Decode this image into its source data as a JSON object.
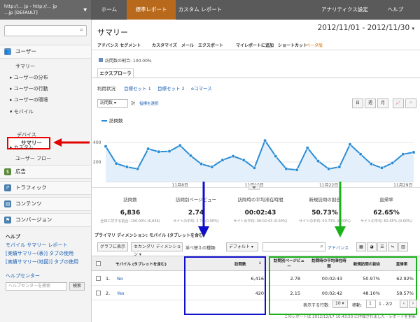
{
  "topbar": {
    "account_line1": "http://… jp - http://… jp",
    "account_line2": "…jp [DEFAULT]",
    "home": "ホーム",
    "standard_reports": "標準レポート",
    "custom_reports": "カスタム レポート",
    "analytics_settings": "アナリティクス設定",
    "help": "ヘルプ"
  },
  "sidebar": {
    "users_section": "ユーザー",
    "items": [
      "サマリー",
      "ユーザーの分布",
      "ユーザーの行動",
      "ユーザーの環境",
      "モバイル"
    ],
    "mobile_children": [
      "サマリー",
      "デバイス"
    ],
    "custom": "カスタム",
    "user_flow": "ユーザー フロー",
    "ads": "広告",
    "traffic": "トラフィック",
    "content": "コンテンツ",
    "conversion": "コンバージョン",
    "help_heading": "ヘルプ",
    "help_links": [
      "モバイル サマリー レポート",
      "[実績サマリー(表)] タブの使用",
      "[実績サマリー(地図)] タブの使用"
    ],
    "help_center": "ヘルプセンター",
    "help_search_placeholder": "ヘルプセンターを検索",
    "help_search_btn": "検索"
  },
  "main": {
    "title": "サマリー",
    "date_range": "2012/11/01 - 2012/11/30",
    "toolbar": {
      "advanced_segments": "アドバンス セグメント",
      "customize": "カスタマイズ",
      "email": "メール",
      "export": "エクスポート",
      "dashboard": "マイレポートに追加",
      "shortcut": "ショートカット",
      "beta": "ベータ版"
    },
    "visits_pct": "訪問数の割合: 100.00%",
    "explorer_tab": "エクスプローラ",
    "subtabs": [
      "利用状況",
      "目標セット 1",
      "目標セット 2",
      "eコマース"
    ],
    "metric_select": "訪問数",
    "vs": "対",
    "metric_compare": "指標を選択",
    "period_buttons": [
      "日",
      "週",
      "月"
    ],
    "legend": "訪問数"
  },
  "chart_data": {
    "type": "line",
    "title": "",
    "series": [
      {
        "name": "訪問数",
        "values": [
          360,
          185,
          150,
          130,
          335,
          305,
          310,
          370,
          265,
          180,
          150,
          220,
          260,
          220,
          140,
          420,
          260,
          130,
          120,
          345,
          210,
          130,
          150,
          380,
          280,
          180,
          140,
          190,
          280,
          300
        ]
      }
    ],
    "x_tick_labels": [
      "11月8日",
      "11月15日",
      "11月22日",
      "11月29日"
    ],
    "y_tick_labels": [
      "400",
      "200"
    ],
    "ylim": [
      0,
      600
    ],
    "grid": true,
    "legend_position": "top-left"
  },
  "stats": [
    {
      "label": "訪問数",
      "value": "6,836",
      "sub": "全体に対する割合: 100.00% (6,836)"
    },
    {
      "label": "訪問別ページビュー",
      "value": "2.74",
      "sub": "サイトの平均: 2.74 (0.00%)"
    },
    {
      "label": "訪問時の平均滞在時間",
      "value": "00:02:43",
      "sub": "サイトの平均: 00:02:43 (0.00%)"
    },
    {
      "label": "新規訪問の割合",
      "value": "50.73%",
      "sub": "サイトの平均: 50.73% (0.00%)"
    },
    {
      "label": "直帰率",
      "value": "62.65%",
      "sub": "サイトの平均: 62.65% (0.00%)"
    }
  ],
  "table": {
    "primary_dimension": "プライマリ ディメンション:  モバイル (タブレットを含む)",
    "graph_btn": "グラフに表示",
    "secondary_dim": "セカンダリ ディメンション",
    "sort_type": "並べ替えの種類:",
    "sort_default": "デフォルト",
    "advanced": "アドバンス",
    "headers": [
      "モバイル (タブレットを含む)",
      "訪問数",
      "訪問別ページビュー",
      "訪問時の平均滞在時間",
      "新規訪問の割合",
      "直帰率"
    ],
    "rows": [
      {
        "idx": "1.",
        "name": "No",
        "visits": "6,416",
        "pv": "2.78",
        "time": "00:02:43",
        "new": "50.97%",
        "bounce": "62.92%"
      },
      {
        "idx": "2.",
        "name": "Yes",
        "visits": "420",
        "pv": "2.15",
        "time": "00:02:42",
        "new": "48.10%",
        "bounce": "58.57%"
      }
    ],
    "rows_label": "表示する行数:",
    "rows_value": "10",
    "goto_label": "移動:",
    "goto_value": "1",
    "range": "1 - 2/2"
  },
  "footer": "このレポートは 2012/12/17 10:43:53 に作成されました - レポートを更新",
  "colors": {
    "accent_orange": "#b8691c",
    "line_blue": "#2b8dd6",
    "annot_red": "#e00000",
    "annot_blue": "#1010cc",
    "annot_green": "#1ab01a"
  }
}
